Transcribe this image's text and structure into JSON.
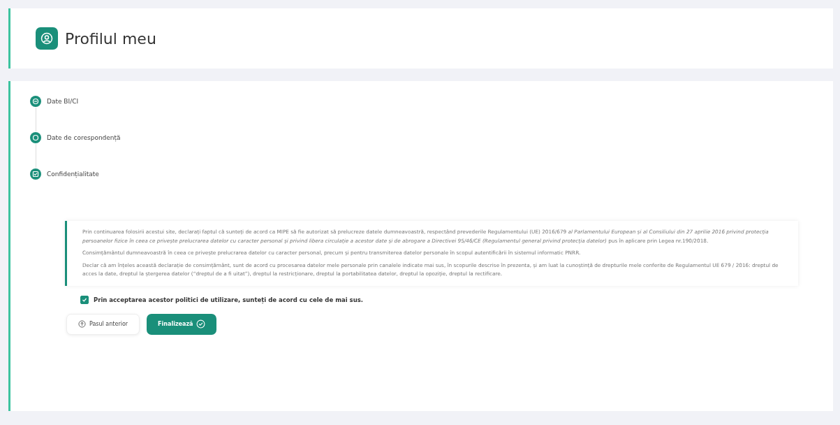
{
  "header": {
    "title": "Profilul meu"
  },
  "steps": [
    {
      "label": "Date BI/CI"
    },
    {
      "label": "Date de corespondență"
    },
    {
      "label": "Confidențialitate"
    }
  ],
  "notice": {
    "paragraphs": [
      "Prin continuarea folosirii acestui site, declarați faptul că sunteți de acord ca MIPE să fie autorizat să prelucreze datele dumneavoastră, respectând prevederile Regulamentului (UE) 2016/679 *al Parlamentului European și al Consiliului din 27 aprilie 2016 privind protecția persoanelor fizice în ceea ce privește prelucrarea datelor cu caracter personal și privind libera circulație a acestor date și de abrogare a Directivei 95/46/CE (Regulamentul general privind protecția datelor)* pus în aplicare prin Legea nr.190/2018.",
      "Consimțământul dumneavoastră în ceea ce privește prelucrarea datelor cu caracter personal, precum și pentru transmiterea datelor personale în scopul autentificării în sistemul informatic PNRR.",
      "Declar că am înțeles această declarație de consimțământ, sunt de acord cu procesarea datelor mele personale prin canalele indicate mai sus, în scopurile descrise în prezenta, și am luat la cunoștință de drepturile mele conferite de Regulamentul UE 679 / 2016: dreptul de acces la date, dreptul la ștergerea datelor (“dreptul de a fi uitat”), dreptul la restricționare, dreptul la portabilitatea datelor, dreptul la opoziție, dreptul la rectificare."
    ]
  },
  "consent": {
    "label": "Prin acceptarea acestor politici de utilizare, sunteți de acord cu cele de mai sus.",
    "checked": true
  },
  "buttons": [
    {
      "kind": "back",
      "label": "Pasul anterior"
    },
    {
      "kind": "finish",
      "label": "Finalizează"
    }
  ]
}
